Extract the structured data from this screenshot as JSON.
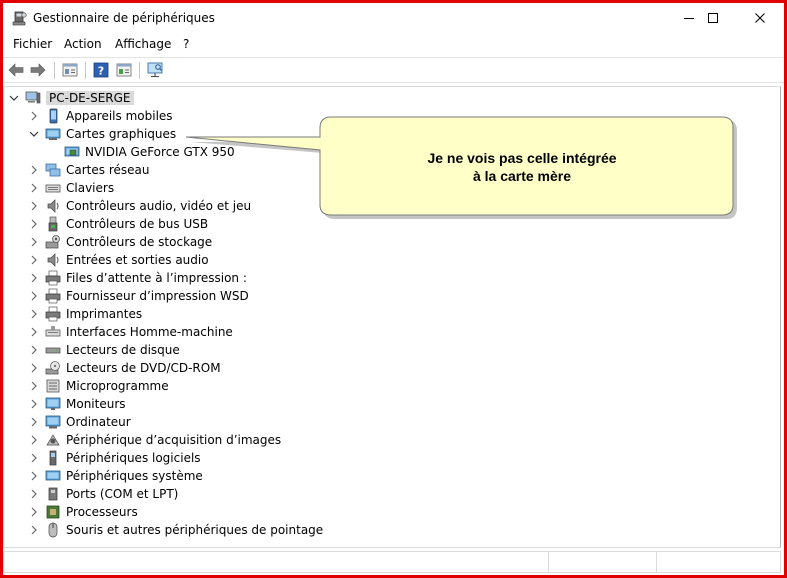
{
  "window": {
    "title": "Gestionnaire de périphériques"
  },
  "menu": {
    "items": [
      "Fichier",
      "Action",
      "Affichage",
      "?"
    ]
  },
  "toolbar": {
    "icons": [
      "back-arrow-icon",
      "forward-arrow-icon",
      "properties-icon",
      "help-icon",
      "update-driver-icon",
      "scan-hardware-icon"
    ]
  },
  "tree": {
    "root": {
      "label": "PC-DE-SERGE",
      "expanded": true
    },
    "categories": [
      {
        "label": "Appareils mobiles",
        "icon": "mobile-device-icon",
        "expanded": false
      },
      {
        "label": "Cartes graphiques",
        "icon": "display-adapter-icon",
        "expanded": true,
        "children": [
          {
            "label": "NVIDIA GeForce GTX 950",
            "icon": "gpu-icon"
          }
        ]
      },
      {
        "label": "Cartes réseau",
        "icon": "network-adapter-icon",
        "expanded": false
      },
      {
        "label": "Claviers",
        "icon": "keyboard-icon",
        "expanded": false
      },
      {
        "label": "Contrôleurs audio, vidéo et jeu",
        "icon": "speaker-icon",
        "expanded": false
      },
      {
        "label": "Contrôleurs de bus USB",
        "icon": "usb-icon",
        "expanded": false
      },
      {
        "label": "Contrôleurs de stockage",
        "icon": "storage-controller-icon",
        "expanded": false
      },
      {
        "label": "Entrées et sorties audio",
        "icon": "speaker-icon",
        "expanded": false
      },
      {
        "label": "Files d’attente à l’impression :",
        "icon": "printer-icon",
        "expanded": false
      },
      {
        "label": "Fournisseur d’impression WSD",
        "icon": "printer-icon",
        "expanded": false
      },
      {
        "label": "Imprimantes",
        "icon": "printer-icon",
        "expanded": false
      },
      {
        "label": "Interfaces Homme-machine",
        "icon": "hid-icon",
        "expanded": false
      },
      {
        "label": "Lecteurs de disque",
        "icon": "disk-drive-icon",
        "expanded": false
      },
      {
        "label": "Lecteurs de DVD/CD-ROM",
        "icon": "dvd-icon",
        "expanded": false
      },
      {
        "label": "Microprogramme",
        "icon": "firmware-icon",
        "expanded": false
      },
      {
        "label": "Moniteurs",
        "icon": "monitor-icon",
        "expanded": false
      },
      {
        "label": "Ordinateur",
        "icon": "computer-icon",
        "expanded": false
      },
      {
        "label": "Périphérique d’acquisition d’images",
        "icon": "camera-icon",
        "expanded": false
      },
      {
        "label": "Périphériques logiciels",
        "icon": "software-device-icon",
        "expanded": false
      },
      {
        "label": "Périphériques système",
        "icon": "system-device-icon",
        "expanded": false
      },
      {
        "label": "Ports (COM et LPT)",
        "icon": "port-icon",
        "expanded": false
      },
      {
        "label": "Processeurs",
        "icon": "processor-icon",
        "expanded": false
      },
      {
        "label": "Souris et autres périphériques de pointage",
        "icon": "mouse-icon",
        "expanded": false
      }
    ]
  },
  "callout": {
    "line1": "Je ne vois pas celle intégrée",
    "line2": "à la carte mère"
  },
  "colors": {
    "frame": "#e00000",
    "callout_fill": "#ffffc8",
    "callout_border": "#7a7a7a",
    "root_highlight": "#dadada"
  }
}
